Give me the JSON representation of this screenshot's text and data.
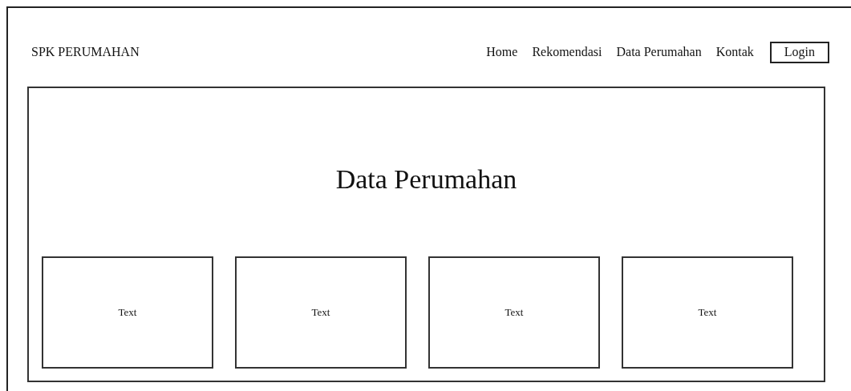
{
  "brand": "SPK PERUMAHAN",
  "nav": [
    {
      "label": "Home",
      "kind": "link"
    },
    {
      "label": "Rekomendasi",
      "kind": "link"
    },
    {
      "label": "Data Perumahan",
      "kind": "link"
    },
    {
      "label": "Kontak",
      "kind": "link"
    },
    {
      "label": "Login",
      "kind": "button"
    }
  ],
  "heading": "Data Perumahan",
  "cards": [
    "Text",
    "Text",
    "Text",
    "Text"
  ]
}
